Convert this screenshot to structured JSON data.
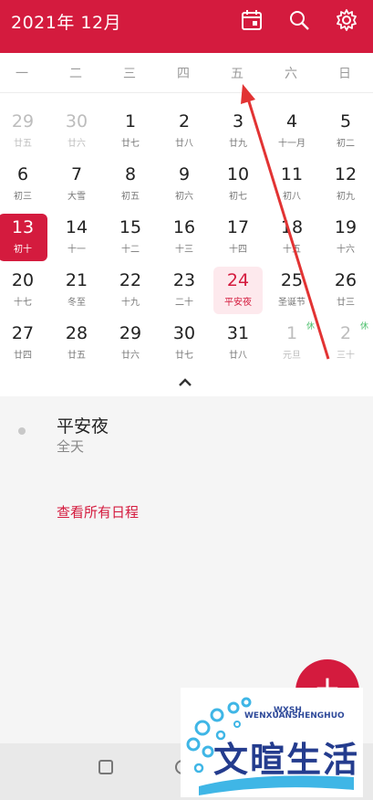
{
  "header": {
    "title": "2021年 12月",
    "icons": [
      "calendar-today-icon",
      "search-icon",
      "gear-icon"
    ]
  },
  "weekdays": [
    "一",
    "二",
    "三",
    "四",
    "五",
    "六",
    "日"
  ],
  "weeks": [
    [
      {
        "day": "29",
        "lunar": "廿五",
        "other": true
      },
      {
        "day": "30",
        "lunar": "廿六",
        "other": true
      },
      {
        "day": "1",
        "lunar": "廿七"
      },
      {
        "day": "2",
        "lunar": "廿八"
      },
      {
        "day": "3",
        "lunar": "廿九"
      },
      {
        "day": "4",
        "lunar": "十一月"
      },
      {
        "day": "5",
        "lunar": "初二"
      }
    ],
    [
      {
        "day": "6",
        "lunar": "初三"
      },
      {
        "day": "7",
        "lunar": "大雪"
      },
      {
        "day": "8",
        "lunar": "初五"
      },
      {
        "day": "9",
        "lunar": "初六"
      },
      {
        "day": "10",
        "lunar": "初七"
      },
      {
        "day": "11",
        "lunar": "初八"
      },
      {
        "day": "12",
        "lunar": "初九"
      }
    ],
    [
      {
        "day": "13",
        "lunar": "初十",
        "selected": true
      },
      {
        "day": "14",
        "lunar": "十一"
      },
      {
        "day": "15",
        "lunar": "十二"
      },
      {
        "day": "16",
        "lunar": "十三"
      },
      {
        "day": "17",
        "lunar": "十四"
      },
      {
        "day": "18",
        "lunar": "十五"
      },
      {
        "day": "19",
        "lunar": "十六"
      }
    ],
    [
      {
        "day": "20",
        "lunar": "十七"
      },
      {
        "day": "21",
        "lunar": "冬至"
      },
      {
        "day": "22",
        "lunar": "十九"
      },
      {
        "day": "23",
        "lunar": "二十"
      },
      {
        "day": "24",
        "lunar": "平安夜",
        "holiday": true
      },
      {
        "day": "25",
        "lunar": "圣诞节"
      },
      {
        "day": "26",
        "lunar": "廿三"
      }
    ],
    [
      {
        "day": "27",
        "lunar": "廿四"
      },
      {
        "day": "28",
        "lunar": "廿五"
      },
      {
        "day": "29",
        "lunar": "廿六"
      },
      {
        "day": "30",
        "lunar": "廿七"
      },
      {
        "day": "31",
        "lunar": "廿八"
      },
      {
        "day": "1",
        "lunar": "元旦",
        "other": true,
        "badge": "休"
      },
      {
        "day": "2",
        "lunar": "三十",
        "other": true,
        "badge": "休"
      }
    ]
  ],
  "event": {
    "title": "平安夜",
    "subtitle": "全天"
  },
  "view_all_label": "查看所有日程",
  "fab_label": "+",
  "watermark": {
    "small1": "WXSH",
    "small2": "WENXUANSHENGHUO",
    "main": "文暄生活"
  },
  "colors": {
    "accent": "#d41b3e",
    "background": "#f5f5f5"
  }
}
